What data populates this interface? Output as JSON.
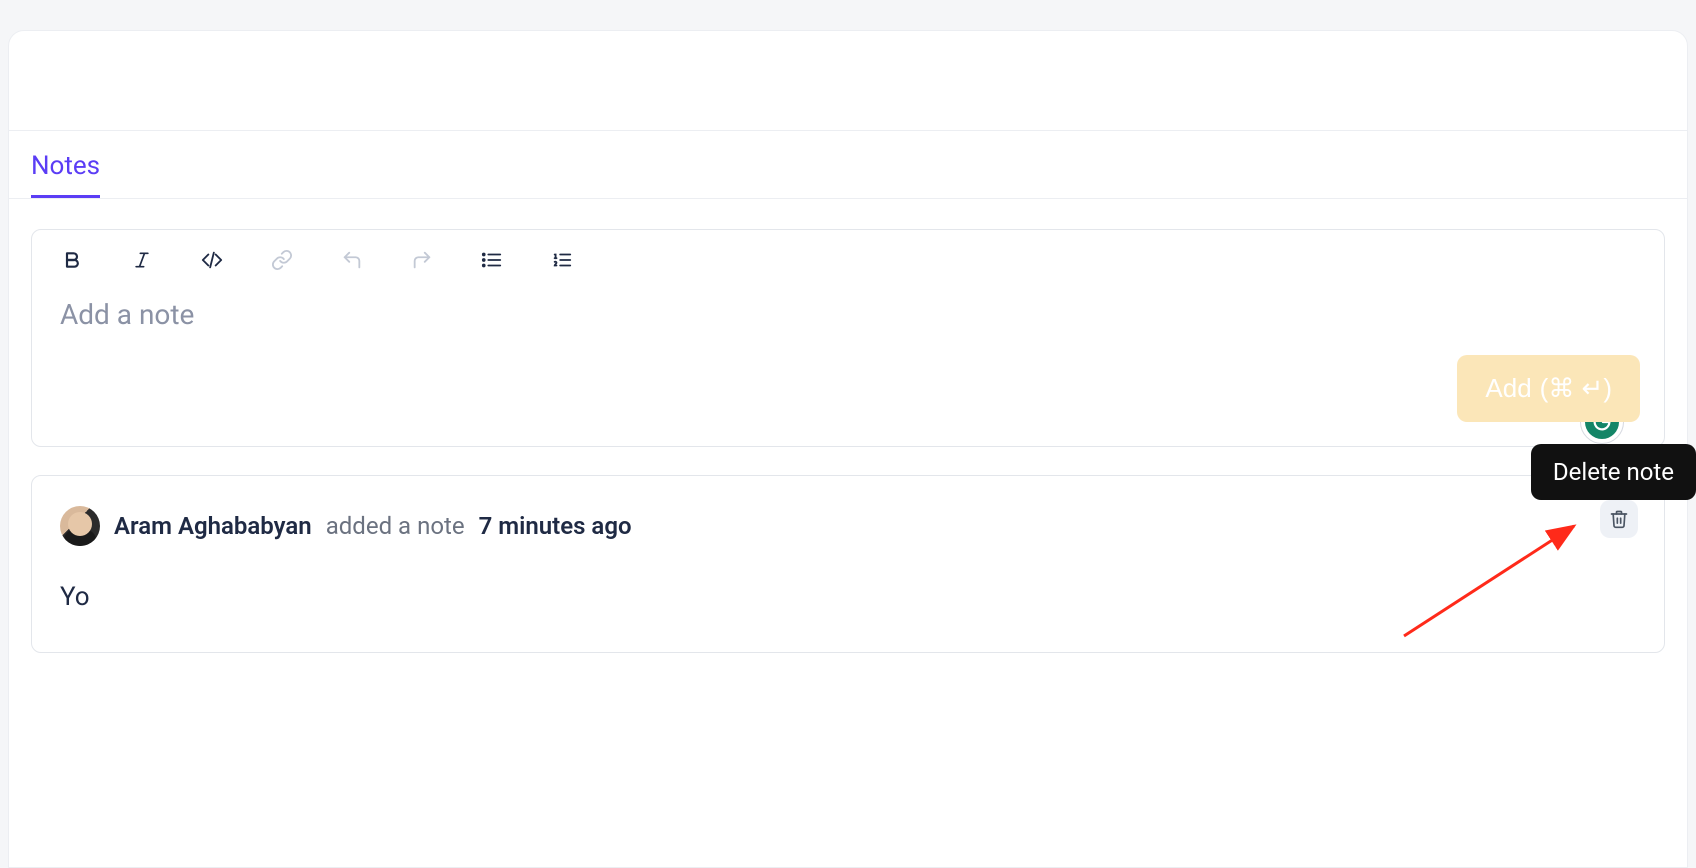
{
  "tabs": {
    "notes_label": "Notes"
  },
  "editor": {
    "placeholder": "Add a note",
    "add_button_label": "Add",
    "shortcut_hint": "(⌘ ↵)"
  },
  "note": {
    "author": "Aram Aghababyan",
    "action_text": "added a note",
    "timestamp": "7 minutes ago",
    "body": "Yo"
  },
  "tooltip": {
    "delete_label": "Delete note"
  },
  "icons": {
    "bold": "bold-icon",
    "italic": "italic-icon",
    "code": "code-icon",
    "link": "link-icon",
    "undo": "undo-icon",
    "redo": "redo-icon",
    "ulist": "bullet-list-icon",
    "olist": "numbered-list-icon",
    "trash": "trash-icon",
    "grammarly": "grammarly-icon"
  }
}
